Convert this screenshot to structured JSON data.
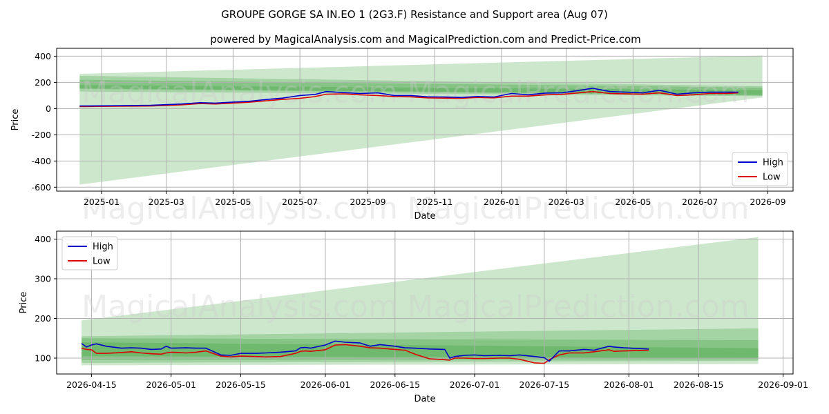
{
  "title_line1": "GROUPE GORGE SA IN.EO 1 (2G3.F) Resistance and Support area (Aug 07)",
  "title_line2": "powered by MagicalAnalysis.com and MagicalPrediction.com and Predict-Price.com",
  "watermark": [
    "MagicalAnalysis.com",
    "MagicalPrediction.com"
  ],
  "colors": {
    "high": "#0000cc",
    "low": "#dd0000",
    "band": "#2e9b2e",
    "grid": "#b0b0b0"
  },
  "chart_data": [
    {
      "type": "line",
      "xlabel": "Date",
      "ylabel": "Price",
      "x_ticks": [
        "2025-01",
        "2025-03",
        "2025-05",
        "2025-07",
        "2025-09",
        "2025-11",
        "2026-01",
        "2026-03",
        "2026-05",
        "2026-07",
        "2026-09"
      ],
      "y_ticks": [
        400,
        200,
        0,
        -200,
        -400,
        -600
      ],
      "ylim": [
        -630,
        460
      ],
      "grid": true,
      "legend": {
        "placement": "lower-right",
        "entries": [
          "High",
          "Low"
        ]
      },
      "series": [
        {
          "name": "High",
          "x": [
            "2024-12-12",
            "2025-01-15",
            "2025-02-15",
            "2025-03-15",
            "2025-04-01",
            "2025-04-15",
            "2025-05-01",
            "2025-05-15",
            "2025-06-01",
            "2025-06-15",
            "2025-07-01",
            "2025-07-15",
            "2025-07-25",
            "2025-08-10",
            "2025-08-25",
            "2025-09-10",
            "2025-09-25",
            "2025-10-10",
            "2025-10-25",
            "2025-11-10",
            "2025-11-25",
            "2025-12-10",
            "2025-12-25",
            "2026-01-10",
            "2026-01-25",
            "2026-02-10",
            "2026-02-25",
            "2026-03-10",
            "2026-03-25",
            "2026-04-10",
            "2026-04-25",
            "2026-05-10",
            "2026-05-25",
            "2026-06-10",
            "2026-06-25",
            "2026-07-10",
            "2026-07-25",
            "2026-08-05"
          ],
          "values": [
            20,
            22,
            25,
            35,
            45,
            42,
            50,
            55,
            70,
            80,
            100,
            108,
            130,
            122,
            115,
            120,
            100,
            100,
            90,
            88,
            85,
            92,
            88,
            115,
            105,
            118,
            120,
            135,
            155,
            130,
            125,
            120,
            140,
            110,
            120,
            125,
            125,
            125
          ]
        },
        {
          "name": "Low",
          "x": [
            "2024-12-12",
            "2025-01-15",
            "2025-02-15",
            "2025-03-15",
            "2025-04-01",
            "2025-04-15",
            "2025-05-01",
            "2025-05-15",
            "2025-06-01",
            "2025-06-15",
            "2025-07-01",
            "2025-07-15",
            "2025-07-25",
            "2025-08-10",
            "2025-08-25",
            "2025-09-10",
            "2025-09-25",
            "2025-10-10",
            "2025-10-25",
            "2025-11-10",
            "2025-11-25",
            "2025-12-10",
            "2025-12-25",
            "2026-01-10",
            "2026-01-25",
            "2026-02-10",
            "2026-02-25",
            "2026-03-10",
            "2026-03-25",
            "2026-04-10",
            "2026-04-25",
            "2026-05-10",
            "2026-05-25",
            "2026-06-10",
            "2026-06-25",
            "2026-07-10",
            "2026-07-25",
            "2026-08-05"
          ],
          "values": [
            15,
            18,
            20,
            28,
            38,
            35,
            42,
            48,
            60,
            70,
            78,
            92,
            110,
            112,
            105,
            100,
            92,
            90,
            82,
            80,
            78,
            85,
            82,
            95,
            95,
            105,
            108,
            118,
            130,
            115,
            112,
            110,
            120,
            100,
            105,
            115,
            115,
            120
          ]
        }
      ],
      "bands": [
        {
          "x": [
            "2024-12-12",
            "2026-08-27"
          ],
          "upper": [
            265,
            405
          ],
          "lower": [
            -580,
            85
          ]
        },
        {
          "x": [
            "2024-12-12",
            "2026-08-27"
          ],
          "upper": [
            250,
            170
          ],
          "lower": [
            130,
            95
          ]
        },
        {
          "x": [
            "2024-12-12",
            "2026-08-27"
          ],
          "upper": [
            220,
            160
          ],
          "lower": [
            150,
            100
          ]
        },
        {
          "x": [
            "2024-12-12",
            "2026-08-27"
          ],
          "upper": [
            180,
            140
          ],
          "lower": [
            155,
            105
          ]
        }
      ]
    },
    {
      "type": "line",
      "xlabel": "Date",
      "ylabel": "Price",
      "x_ticks": [
        "2026-04-15",
        "2026-05-01",
        "2026-05-15",
        "2026-06-01",
        "2026-06-15",
        "2026-07-01",
        "2026-07-15",
        "2026-08-01",
        "2026-08-15",
        "2026-09-01"
      ],
      "y_ticks": [
        400,
        300,
        200,
        100
      ],
      "ylim": [
        60,
        420
      ],
      "grid": true,
      "legend": {
        "placement": "upper-left",
        "entries": [
          "High",
          "Low"
        ]
      },
      "series": [
        {
          "name": "High",
          "x": [
            "2026-04-13",
            "2026-04-14",
            "2026-04-15",
            "2026-04-16",
            "2026-04-18",
            "2026-04-21",
            "2026-04-23",
            "2026-04-25",
            "2026-04-27",
            "2026-04-29",
            "2026-04-30",
            "2026-05-01",
            "2026-05-04",
            "2026-05-06",
            "2026-05-08",
            "2026-05-11",
            "2026-05-13",
            "2026-05-15",
            "2026-05-18",
            "2026-05-20",
            "2026-05-23",
            "2026-05-26",
            "2026-05-27",
            "2026-05-28",
            "2026-05-29",
            "2026-06-01",
            "2026-06-03",
            "2026-06-05",
            "2026-06-08",
            "2026-06-10",
            "2026-06-12",
            "2026-06-15",
            "2026-06-17",
            "2026-06-19",
            "2026-06-22",
            "2026-06-25",
            "2026-06-26",
            "2026-06-27",
            "2026-06-29",
            "2026-07-01",
            "2026-07-03",
            "2026-07-06",
            "2026-07-08",
            "2026-07-10",
            "2026-07-13",
            "2026-07-15",
            "2026-07-16",
            "2026-07-18",
            "2026-07-20",
            "2026-07-23",
            "2026-07-25",
            "2026-07-28",
            "2026-07-29",
            "2026-07-31",
            "2026-08-03",
            "2026-08-05"
          ],
          "values": [
            137,
            128,
            133,
            136,
            130,
            125,
            126,
            125,
            122,
            123,
            130,
            125,
            126,
            125,
            125,
            108,
            107,
            112,
            112,
            113,
            115,
            118,
            126,
            127,
            125,
            133,
            143,
            140,
            138,
            130,
            134,
            130,
            126,
            125,
            123,
            122,
            100,
            104,
            107,
            108,
            106,
            107,
            106,
            108,
            104,
            101,
            92,
            118,
            118,
            122,
            120,
            130,
            128,
            126,
            124,
            123
          ]
        },
        {
          "name": "Low",
          "x": [
            "2026-04-13",
            "2026-04-14",
            "2026-04-15",
            "2026-04-16",
            "2026-04-18",
            "2026-04-21",
            "2026-04-23",
            "2026-04-25",
            "2026-04-27",
            "2026-04-29",
            "2026-04-30",
            "2026-05-01",
            "2026-05-04",
            "2026-05-06",
            "2026-05-08",
            "2026-05-11",
            "2026-05-13",
            "2026-05-15",
            "2026-05-18",
            "2026-05-20",
            "2026-05-23",
            "2026-05-26",
            "2026-05-27",
            "2026-05-28",
            "2026-05-29",
            "2026-06-01",
            "2026-06-03",
            "2026-06-05",
            "2026-06-08",
            "2026-06-10",
            "2026-06-12",
            "2026-06-15",
            "2026-06-17",
            "2026-06-19",
            "2026-06-22",
            "2026-06-25",
            "2026-06-26",
            "2026-06-27",
            "2026-06-29",
            "2026-07-01",
            "2026-07-03",
            "2026-07-06",
            "2026-07-08",
            "2026-07-10",
            "2026-07-13",
            "2026-07-15",
            "2026-07-16",
            "2026-07-18",
            "2026-07-20",
            "2026-07-23",
            "2026-07-25",
            "2026-07-28",
            "2026-07-29",
            "2026-07-31",
            "2026-08-03",
            "2026-08-05"
          ],
          "values": [
            125,
            122,
            121,
            112,
            112,
            114,
            116,
            113,
            111,
            110,
            113,
            115,
            113,
            115,
            118,
            105,
            103,
            105,
            104,
            103,
            104,
            112,
            117,
            118,
            117,
            121,
            133,
            134,
            130,
            126,
            125,
            122,
            120,
            110,
            98,
            96,
            95,
            100,
            100,
            99,
            99,
            100,
            100,
            97,
            88,
            87,
            96,
            108,
            113,
            113,
            116,
            121,
            117,
            118,
            119,
            120
          ]
        }
      ],
      "bands": [
        {
          "x": [
            "2026-04-13",
            "2026-08-27"
          ],
          "upper": [
            195,
            405
          ],
          "lower": [
            82,
            85
          ]
        },
        {
          "x": [
            "2026-04-13",
            "2026-08-27"
          ],
          "upper": [
            155,
            175
          ],
          "lower": [
            88,
            93
          ]
        },
        {
          "x": [
            "2026-04-13",
            "2026-08-27"
          ],
          "upper": [
            150,
            145
          ],
          "lower": [
            95,
            97
          ]
        },
        {
          "x": [
            "2026-04-13",
            "2026-08-27"
          ],
          "upper": [
            140,
            125
          ],
          "lower": [
            105,
            100
          ]
        }
      ]
    }
  ]
}
